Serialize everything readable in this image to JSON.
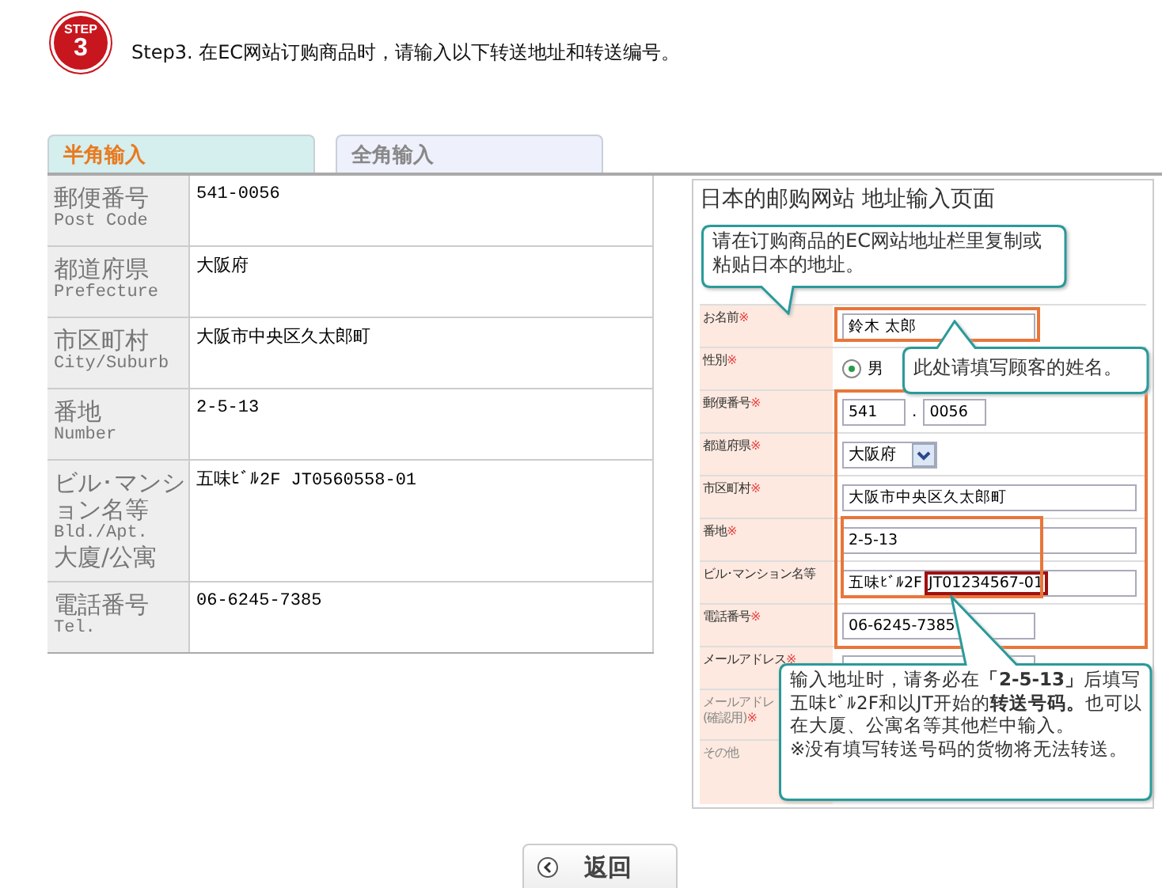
{
  "step": {
    "badge_word": "STEP",
    "badge_number": "3",
    "instruction": "Step3. 在EC网站订购商品时，请输入以下转送地址和转送编号。"
  },
  "tabs": [
    {
      "label": "半角输入",
      "selected": true
    },
    {
      "label": "全角输入",
      "selected": false
    }
  ],
  "address_table": {
    "rows": [
      {
        "label": [
          "郵便番号"
        ],
        "label_en": "Post Code",
        "value": "541-0056"
      },
      {
        "label": [
          "都道府県"
        ],
        "label_en": "Prefecture",
        "value": "大阪府"
      },
      {
        "label": [
          "市区町村"
        ],
        "label_en": "City/Suburb",
        "value": "大阪市中央区久太郎町"
      },
      {
        "label": [
          "番地"
        ],
        "label_en": "Number",
        "value": "2-5-13"
      },
      {
        "label": [
          "ビル･マンション名等"
        ],
        "label_en": "Bld./Apt.",
        "label_extra": "大廈/公寓",
        "value": "五味ﾋﾞﾙ2F JT0560558-01"
      },
      {
        "label": [
          "電話番号"
        ],
        "label_en": "Tel.",
        "value": "06-6245-7385"
      }
    ]
  },
  "example": {
    "title": "日本的邮购网站 地址输入页面",
    "form": [
      {
        "kind": "text",
        "label": [
          "お名前"
        ],
        "mark": "※",
        "value": "鈴木  太郎"
      },
      {
        "kind": "radio",
        "label": [
          "性別"
        ],
        "mark": "※",
        "value": "男",
        "selected": true
      },
      {
        "kind": "split",
        "label": [
          "郵便番号"
        ],
        "mark": "※",
        "value": "541",
        "separator": ".",
        "value_2": "0056"
      },
      {
        "kind": "select",
        "label": [
          "都道府県"
        ],
        "mark": "※",
        "value": "大阪府"
      },
      {
        "kind": "long_text",
        "label": [
          "市区町村"
        ],
        "mark": "※",
        "value": "大阪市中央区久太郎町"
      },
      {
        "kind": "long_text",
        "label": [
          "番地"
        ],
        "mark": "※",
        "value": "2-5-13"
      },
      {
        "kind": "long_text",
        "label": [
          "ビル･マンション名等"
        ],
        "value": "五味ﾋﾞﾙ2F",
        "highlight": "JT01234567-01"
      },
      {
        "kind": "text",
        "label": [
          "電話番号"
        ],
        "mark": "※",
        "value": "06-6245-7385"
      },
      {
        "kind": "text",
        "label": [
          "メールアドレス"
        ],
        "mark": "※"
      },
      {
        "kind": "blank",
        "label": [
          "メールアドレ",
          "(確認用)"
        ],
        "mark": "※"
      },
      {
        "kind": "blank",
        "label": [
          "その他"
        ]
      }
    ],
    "callouts": [
      {
        "kind": "top",
        "text": "请在订购商品的EC网站地址栏里复制或粘贴日本的地址。"
      },
      {
        "kind": "name",
        "text": "此处请填写顾客的姓名。"
      },
      {
        "kind": "bottom",
        "text": "输入地址时，请务必在**「2-5-13」**后填写五味ﾋﾞﾙ2F和以JT开始的**转送号码。**也可以在大厦、公寓名等其他栏中输入。",
        "note": "※没有填写转送号码的货物将无法转送。"
      }
    ]
  },
  "back_button": {
    "label": "返回"
  }
}
